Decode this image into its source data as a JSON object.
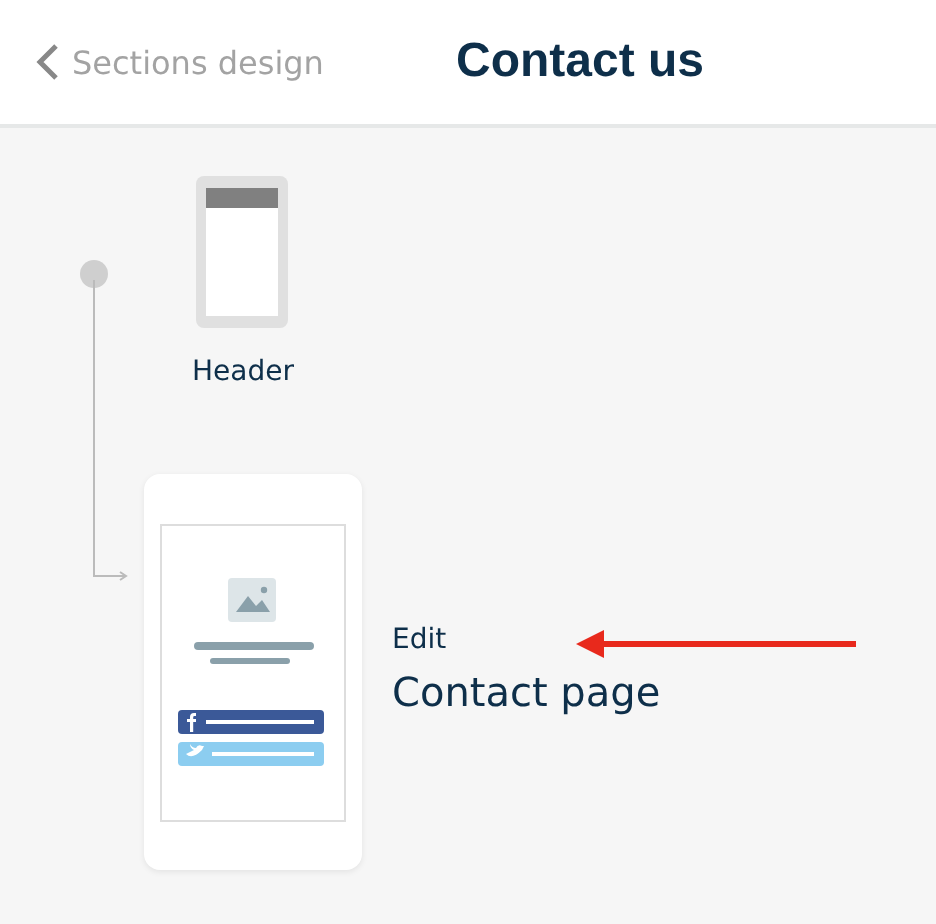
{
  "nav": {
    "back_label": "Sections design",
    "title": "Contact us"
  },
  "sections": [
    {
      "kind": "header",
      "label": "Header"
    },
    {
      "kind": "contact",
      "action": "Edit",
      "label": "Contact page"
    }
  ]
}
